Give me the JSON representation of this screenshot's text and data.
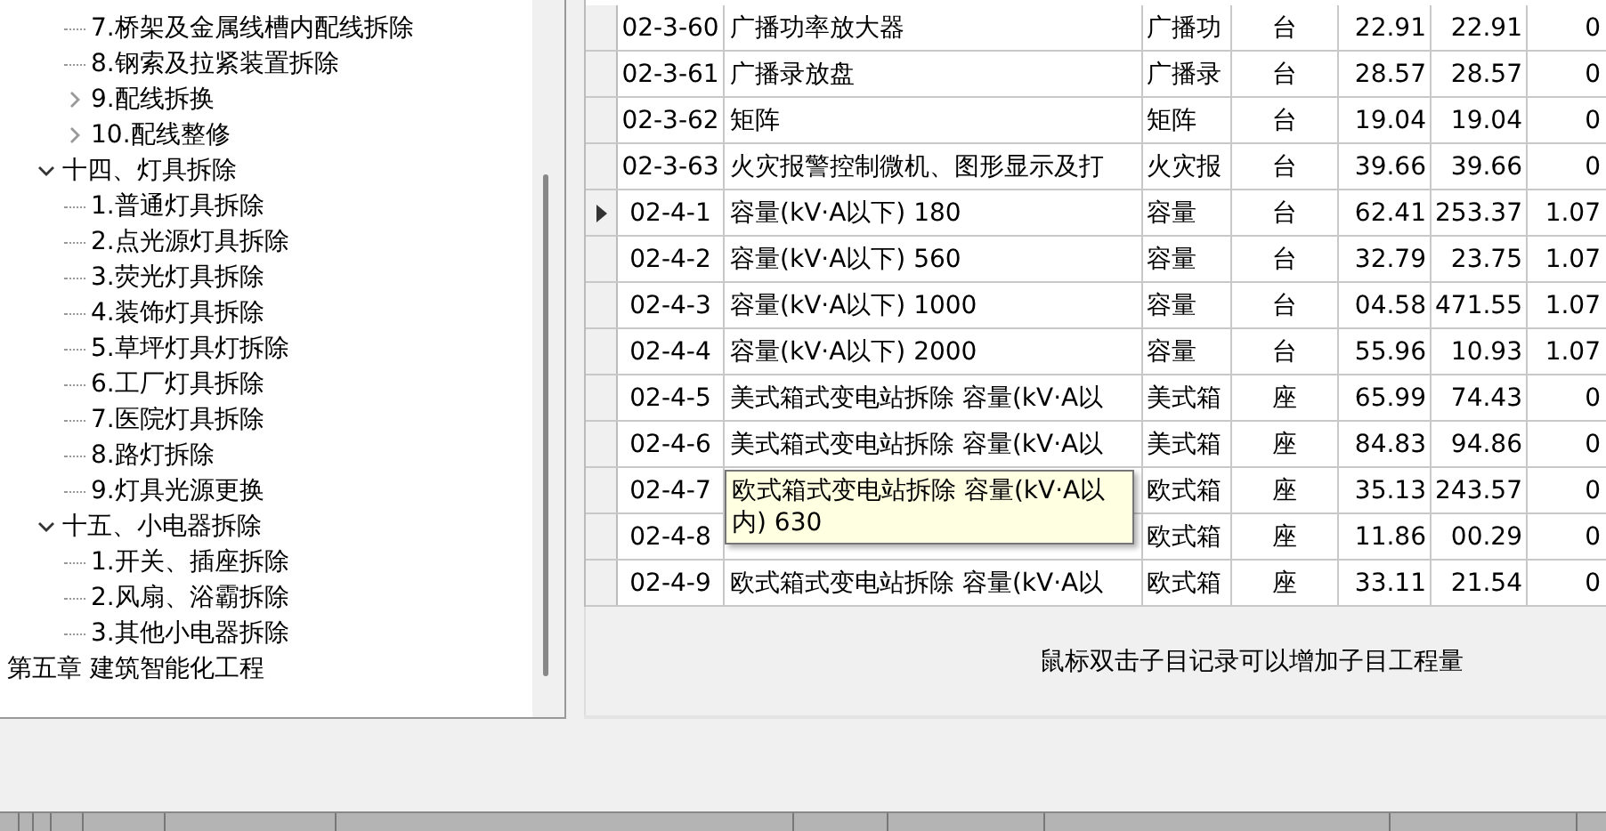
{
  "tree": {
    "items": [
      {
        "children": [
          {
            "children": [
              {
                "label": "7.桥架及金属线槽内配线拆除"
              },
              {
                "label": "8.钢索及拉紧装置拆除"
              },
              {
                "label": "9.配线拆换",
                "expanded": false
              },
              {
                "label": "10.配线整修",
                "expanded": false
              }
            ]
          },
          {
            "label": "十四、灯具拆除",
            "expanded": true,
            "children": [
              {
                "label": "1.普通灯具拆除"
              },
              {
                "label": "2.点光源灯具拆除"
              },
              {
                "label": "3.荧光灯具拆除"
              },
              {
                "label": "4.装饰灯具拆除"
              },
              {
                "label": "5.草坪灯具灯拆除"
              },
              {
                "label": "6.工厂灯具拆除"
              },
              {
                "label": "7.医院灯具拆除"
              },
              {
                "label": "8.路灯拆除"
              },
              {
                "label": "9.灯具光源更换"
              }
            ]
          },
          {
            "label": "十五、小电器拆除",
            "expanded": true,
            "children": [
              {
                "label": "1.开关、插座拆除"
              },
              {
                "label": "2.风扇、浴霸拆除"
              },
              {
                "label": "3.其他小电器拆除"
              }
            ]
          }
        ]
      },
      {
        "label": "第五章 建筑智能化工程"
      }
    ]
  },
  "table": {
    "rows": [
      {
        "selected": false,
        "code": "02-3-60",
        "name": "广播功率放大器",
        "column_3": "广播功",
        "unit": "台",
        "column_5": "22.91",
        "column_6": "22.91",
        "column_7": "0"
      },
      {
        "selected": false,
        "code": "02-3-61",
        "name": "广播录放盘",
        "column_3": "广播录",
        "unit": "台",
        "column_5": "28.57",
        "column_6": "28.57",
        "column_7": "0"
      },
      {
        "selected": false,
        "code": "02-3-62",
        "name": "矩阵",
        "column_3": "矩阵",
        "unit": "台",
        "column_5": "19.04",
        "column_6": "19.04",
        "column_7": "0"
      },
      {
        "selected": false,
        "code": "02-3-63",
        "name": "火灾报警控制微机、图形显示及打",
        "column_3": "火灾报",
        "unit": "台",
        "column_5": "39.66",
        "column_6": "39.66",
        "column_7": "0"
      },
      {
        "selected": true,
        "code": "02-4-1",
        "name": "容量(kV·A以下) 180",
        "column_3": "容量",
        "unit": "台",
        "column_5": "62.41",
        "column_6": "253.37",
        "column_7": "1.07"
      },
      {
        "selected": false,
        "code": "02-4-2",
        "name": "容量(kV·A以下) 560",
        "column_3": "容量",
        "unit": "台",
        "column_5": "32.79",
        "column_6": "23.75",
        "column_7": "1.07"
      },
      {
        "selected": false,
        "code": "02-4-3",
        "name": "容量(kV·A以下) 1000",
        "column_3": "容量",
        "unit": "台",
        "column_5": "04.58",
        "column_6": "471.55",
        "column_7": "1.07"
      },
      {
        "selected": false,
        "code": "02-4-4",
        "name": "容量(kV·A以下) 2000",
        "column_3": "容量",
        "unit": "台",
        "column_5": "55.96",
        "column_6": "10.93",
        "column_7": "1.07"
      },
      {
        "selected": false,
        "code": "02-4-5",
        "name": "美式箱式变电站拆除 容量(kV·A以",
        "column_3": "美式箱",
        "unit": "座",
        "column_5": "65.99",
        "column_6": "74.43",
        "column_7": "0"
      },
      {
        "selected": false,
        "code": "02-4-6",
        "name": "美式箱式变电站拆除 容量(kV·A以",
        "column_3": "美式箱",
        "unit": "座",
        "column_5": "84.83",
        "column_6": "94.86",
        "column_7": "0"
      },
      {
        "selected": false,
        "code": "02-4-7",
        "column_3": "欧式箱",
        "unit": "座",
        "column_5": "35.13",
        "column_6": "243.57",
        "column_7": "0"
      },
      {
        "selected": false,
        "code": "02-4-8",
        "column_3": "欧式箱",
        "unit": "座",
        "column_5": "11.86",
        "column_6": "00.29",
        "column_7": "0"
      },
      {
        "selected": false,
        "code": "02-4-9",
        "name": "欧式箱式变电站拆除 容量(kV·A以",
        "column_3": "欧式箱",
        "unit": "座",
        "column_5": "33.11",
        "column_6": "21.54",
        "column_7": "0"
      }
    ],
    "tooltip": "欧式箱式变电站拆除 容量(kV·A以内) 630"
  },
  "hint": "鼠标双击子目记录可以增加子目工程量"
}
